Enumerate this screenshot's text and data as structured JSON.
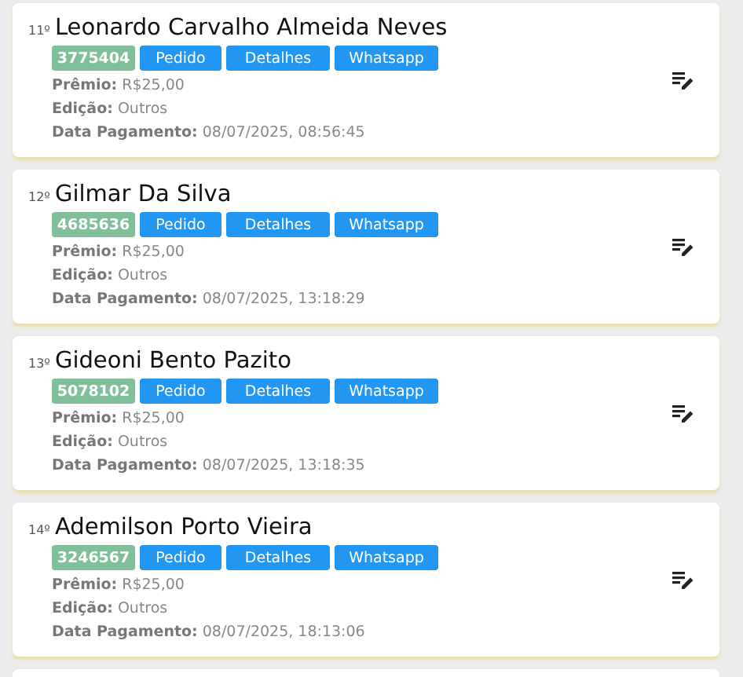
{
  "entries": [
    {
      "rank": "11º",
      "name": "Leonardo Carvalho Almeida Neves",
      "code": "3775404",
      "buttons": [
        "Pedido",
        "Detalhes",
        "Whatsapp"
      ],
      "fields": [
        {
          "label": "Prêmio:",
          "value": "R$25,00"
        },
        {
          "label": "Edição:",
          "value": "Outros"
        },
        {
          "label": "Data Pagamento:",
          "value": "08/07/2025, 08:56:45"
        }
      ]
    },
    {
      "rank": "12º",
      "name": "Gilmar Da Silva",
      "code": "4685636",
      "buttons": [
        "Pedido",
        "Detalhes",
        "Whatsapp"
      ],
      "fields": [
        {
          "label": "Prêmio:",
          "value": "R$25,00"
        },
        {
          "label": "Edição:",
          "value": "Outros"
        },
        {
          "label": "Data Pagamento:",
          "value": "08/07/2025, 13:18:29"
        }
      ]
    },
    {
      "rank": "13º",
      "name": "Gideoni Bento Pazito",
      "code": "5078102",
      "buttons": [
        "Pedido",
        "Detalhes",
        "Whatsapp"
      ],
      "fields": [
        {
          "label": "Prêmio:",
          "value": "R$25,00"
        },
        {
          "label": "Edição:",
          "value": "Outros"
        },
        {
          "label": "Data Pagamento:",
          "value": "08/07/2025, 13:18:35"
        }
      ]
    },
    {
      "rank": "14º",
      "name": "Ademilson Porto Vieira",
      "code": "3246567",
      "buttons": [
        "Pedido",
        "Detalhes",
        "Whatsapp"
      ],
      "fields": [
        {
          "label": "Prêmio:",
          "value": "R$25,00"
        },
        {
          "label": "Edição:",
          "value": "Outros"
        },
        {
          "label": "Data Pagamento:",
          "value": "08/07/2025, 18:13:06"
        }
      ]
    }
  ]
}
